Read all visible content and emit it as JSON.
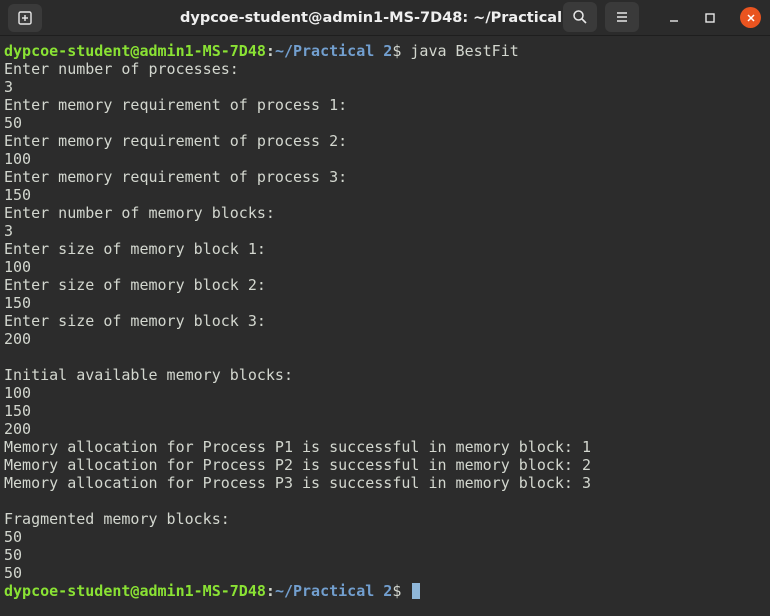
{
  "window": {
    "title": "dypcoe-student@admin1-MS-7D48: ~/Practical 2"
  },
  "prompt": {
    "user_host": "dypcoe-student@admin1-MS-7D48",
    "separator": ":",
    "path": "~/Practical 2",
    "symbol": "$"
  },
  "command": "java BestFit",
  "output_lines": [
    "Enter number of processes:",
    "3",
    "Enter memory requirement of process 1:",
    "50",
    "Enter memory requirement of process 2:",
    "100",
    "Enter memory requirement of process 3:",
    "150",
    "Enter number of memory blocks:",
    "3",
    "Enter size of memory block 1:",
    "100",
    "Enter size of memory block 2:",
    "150",
    "Enter size of memory block 3:",
    "200",
    "",
    "Initial available memory blocks:",
    "100",
    "150",
    "200",
    "Memory allocation for Process P1 is successful in memory block: 1",
    "Memory allocation for Process P2 is successful in memory block: 2",
    "Memory allocation for Process P3 is successful in memory block: 3",
    "",
    "Fragmented memory blocks:",
    "50",
    "50",
    "50"
  ],
  "colors": {
    "background": "#2c2c2c",
    "text": "#d3d7cf",
    "prompt_user": "#8ae234",
    "prompt_path": "#729fcf",
    "close_button": "#e95420"
  },
  "icons": [
    "new-tab-icon",
    "search-icon",
    "hamburger-menu-icon",
    "minimize-icon",
    "maximize-icon",
    "close-icon"
  ]
}
